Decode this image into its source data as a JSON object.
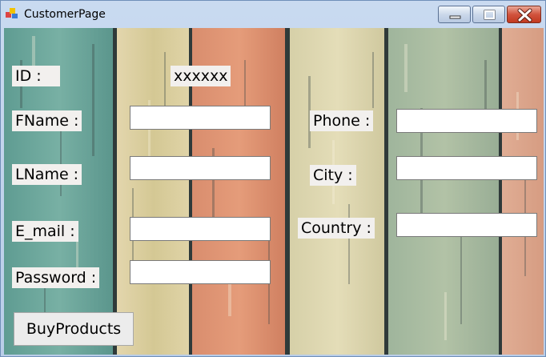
{
  "window": {
    "title": "CustomerPage",
    "icon": "winforms-app-icon"
  },
  "caption_buttons": [
    {
      "name": "minimize-button",
      "icon": "minimize-icon"
    },
    {
      "name": "maximize-button",
      "icon": "maximize-icon"
    },
    {
      "name": "close-button",
      "icon": "close-icon"
    }
  ],
  "form": {
    "id_label": "ID :",
    "id_value": "xxxxxx",
    "fname_label": "FName :",
    "lname_label": "LName :",
    "email_label": "E_mail :",
    "password_label": "Password :",
    "phone_label": "Phone :",
    "city_label": "City :",
    "country_label": "Country :",
    "fname_value": "",
    "lname_value": "",
    "email_value": "",
    "password_value": "",
    "phone_value": "",
    "city_value": "",
    "country_value": "",
    "buy_button_label": "BuyProducts"
  },
  "colors": {
    "titlebar": "#c9daf0",
    "label_bg": "#f2f0ee",
    "close_button": "#c2391f",
    "background_teal": "#6aa39a",
    "background_cream": "#d9cfa6",
    "background_salmon": "#d98a6b",
    "background_sage": "#a9b8a0"
  }
}
